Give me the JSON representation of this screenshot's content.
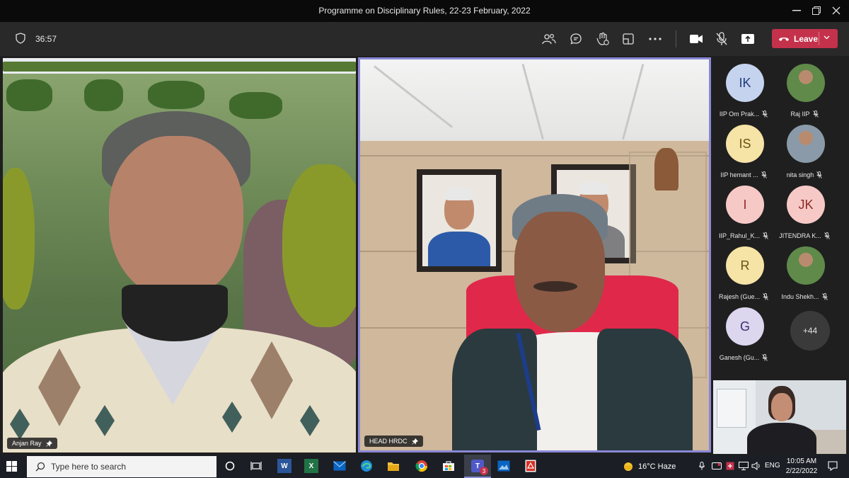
{
  "window": {
    "title": "Programme on Disciplinary Rules, 22-23 February, 2022"
  },
  "meeting": {
    "timer": "36:57",
    "leave_label": "Leave",
    "leave_color": "#c4314b",
    "icons": [
      "people-icon",
      "chat-icon",
      "reactions-icon",
      "rooms-icon",
      "more-options-icon",
      "camera-icon",
      "mic-muted-icon",
      "share-icon"
    ]
  },
  "video": {
    "left": {
      "name": "Anjan Ray",
      "pinned": true
    },
    "right": {
      "name": "HEAD HRDC",
      "pinned": true,
      "highlight_color": "#8a88d8"
    }
  },
  "roster": [
    {
      "initials": "IK",
      "name": "IIP Om Prak...",
      "muted": true,
      "avatar_color": "#c5d3ef",
      "initials_color": "#1f3d7a"
    },
    {
      "initials": "",
      "name": "Raj IIP",
      "muted": true,
      "photo": true
    },
    {
      "initials": "IS",
      "name": "IIP hemant ...",
      "muted": true,
      "avatar_color": "#f6e3a6",
      "initials_color": "#6b5310"
    },
    {
      "initials": "",
      "name": "nita singh",
      "muted": true,
      "photo": true
    },
    {
      "initials": "I",
      "name": "IIP_Rahul_K...",
      "muted": true,
      "avatar_color": "#f7c9c6",
      "initials_color": "#8a2b26"
    },
    {
      "initials": "JK",
      "name": "JITENDRA K...",
      "muted": true,
      "avatar_color": "#f7c9c6",
      "initials_color": "#8a2b26"
    },
    {
      "initials": "R",
      "name": "Rajesh (Gue...",
      "muted": true,
      "avatar_color": "#f6e3a6",
      "initials_color": "#6b5310"
    },
    {
      "initials": "",
      "name": "Indu Shekh...",
      "muted": true,
      "photo": true
    },
    {
      "initials": "G",
      "name": "Ganesh (Gu...",
      "muted": true,
      "avatar_color": "#dcd6ef",
      "initials_color": "#3c2f6b"
    }
  ],
  "more_participants": "+44",
  "taskbar": {
    "search_placeholder": "Type here to search",
    "teams_badge": "3",
    "weather": "16°C  Haze",
    "language": "ENG",
    "time": "10:05 AM",
    "date": "2/22/2022"
  }
}
